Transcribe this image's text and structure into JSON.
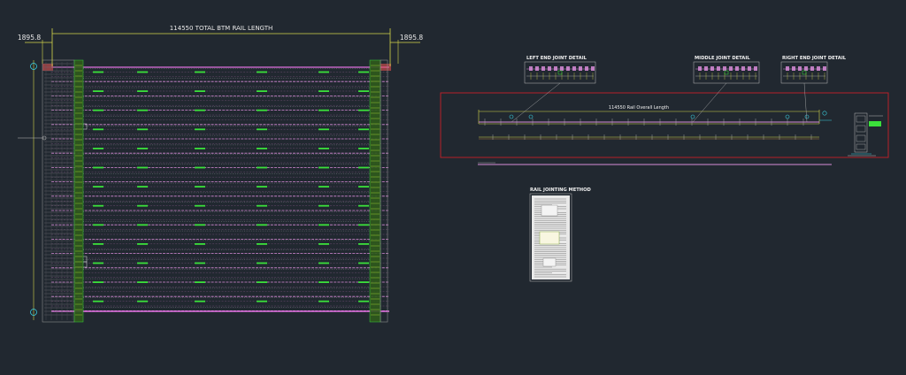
{
  "drawing": {
    "colors": {
      "background": "#212830",
      "dimension": "#d6d64a",
      "rail": "#d88bd8",
      "rail_dark": "#6a4a6e",
      "bolt": "#3be03b",
      "frame": "#c8c8c8",
      "grid": "#8a8a8a",
      "border_red": "#c8202a",
      "cyan": "#3ad0e0",
      "text": "#f0f0f0",
      "sheet": "#e8e8e8"
    },
    "plan": {
      "total_length_label": "114550  TOTAL  BTM  RAIL  LENGTH",
      "left_offset_label": "1895.8",
      "right_offset_label": "1895.8"
    },
    "details": {
      "left_title": "LEFT END JOINT DETAIL",
      "middle_title": "MIDDLE JOINT DETAIL",
      "right_title": "RIGHT END JOINT DETAIL",
      "overall_label": "114550 Rail Overall Length"
    },
    "method": {
      "title": "RAIL JOINTING METHOD"
    }
  }
}
